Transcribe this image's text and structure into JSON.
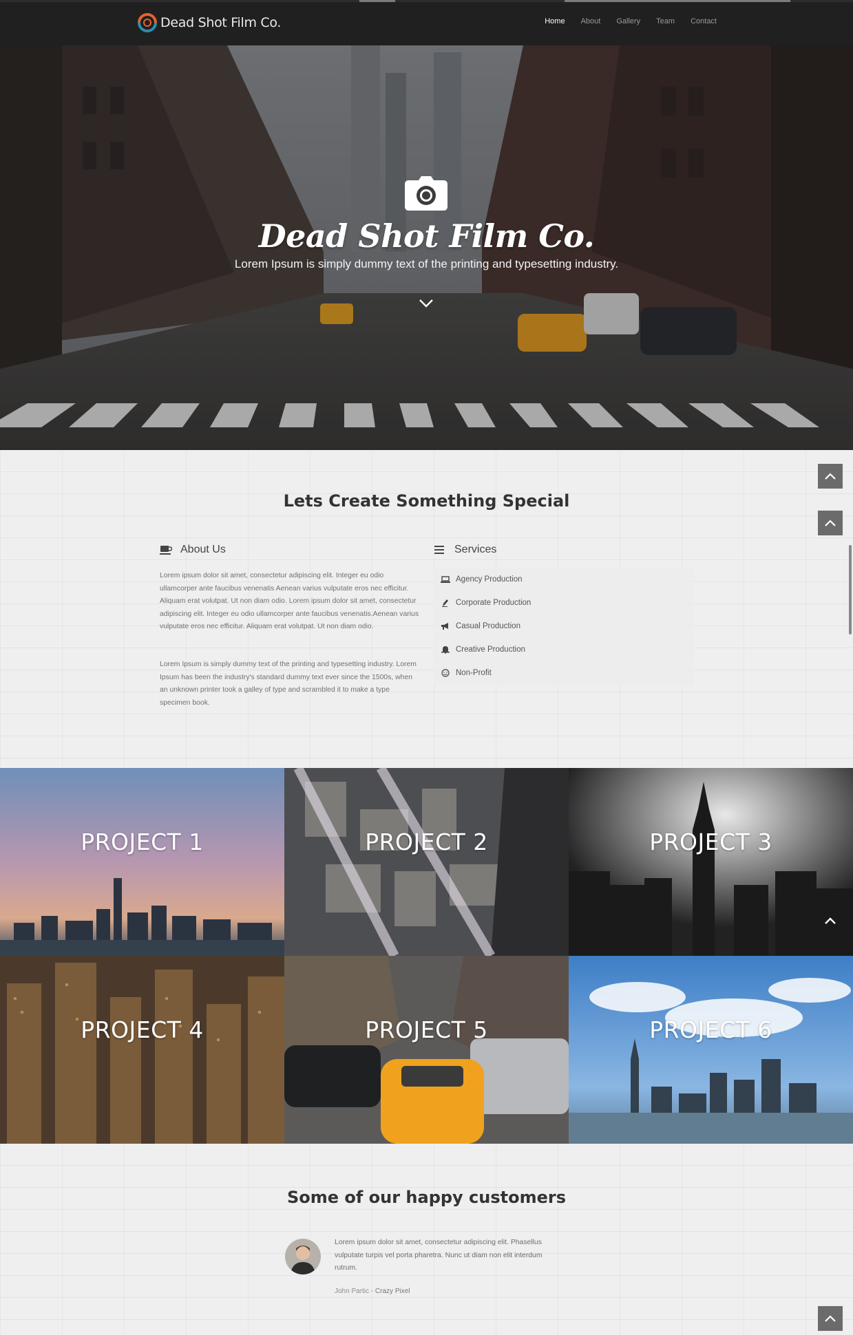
{
  "header": {
    "brand_name": "Dead Shot Film Co.",
    "nav": [
      {
        "label": "Home",
        "active": true
      },
      {
        "label": "About",
        "active": false
      },
      {
        "label": "Gallery",
        "active": false
      },
      {
        "label": "Team",
        "active": false
      },
      {
        "label": "Contact",
        "active": false
      }
    ]
  },
  "hero": {
    "title": "Dead Shot Film Co.",
    "subtitle": "Lorem Ipsum is simply dummy text of the printing and typesetting industry.",
    "icon": "camera-icon",
    "scroll_icon": "chevron-down-icon"
  },
  "intro": {
    "title": "Lets Create Something Special",
    "about": {
      "heading": "About Us",
      "icon": "coffee-cup-icon",
      "paragraph_1": "Lorem ipsum dolor sit amet, consectetur adipiscing elit. Integer eu odio ullamcorper ante faucibus venenatis Aenean varius vulputate eros nec efficitur. Aliquam erat volutpat. Ut non diam odio. Lorem ipsum dolor sit amet, consectetur adipiscing elit. Integer eu odio ullamcorper ante faucibus venenatis.Aenean varius vulputate eros nec efficitur. Aliquam erat volutpat. Ut non diam odio.",
      "paragraph_2": "Lorem Ipsum is simply dummy text of the printing and typesetting industry. Lorem Ipsum has been the industry's standard dummy text ever since the 1500s, when an unknown printer took a galley of type and scrambled it to make a type specimen book."
    },
    "services": {
      "heading": "Services",
      "icon": "list-icon",
      "items": [
        {
          "label": "Agency Production",
          "icon": "laptop-icon"
        },
        {
          "label": "Corporate Production",
          "icon": "pen-icon"
        },
        {
          "label": "Casual Production",
          "icon": "bullhorn-icon"
        },
        {
          "label": "Creative Production",
          "icon": "bell-icon"
        },
        {
          "label": "Non-Profit",
          "icon": "smile-icon"
        }
      ]
    }
  },
  "projects": [
    {
      "label": "PROJECT 1"
    },
    {
      "label": "PROJECT 2"
    },
    {
      "label": "PROJECT 3"
    },
    {
      "label": "PROJECT 4"
    },
    {
      "label": "PROJECT 5"
    },
    {
      "label": "PROJECT 6"
    }
  ],
  "customers": {
    "title": "Some of our happy customers",
    "testimonial": {
      "text": "Lorem ipsum dolor sit amet, consectetur adipiscing elit. Phasellus vulputate turpis vel porta pharetra. Nunc ut diam non elit interdum rutrum.",
      "author": "John Partic",
      "company": "Crazy Pixel",
      "separator": " - "
    }
  },
  "controls": {
    "scroll_top_icon": "chevron-up-icon"
  },
  "colors": {
    "header_bg": "#202020",
    "accent_orange": "#e9622a",
    "accent_teal": "#2a8fb0",
    "scroll_button": "#6b6b6b"
  }
}
